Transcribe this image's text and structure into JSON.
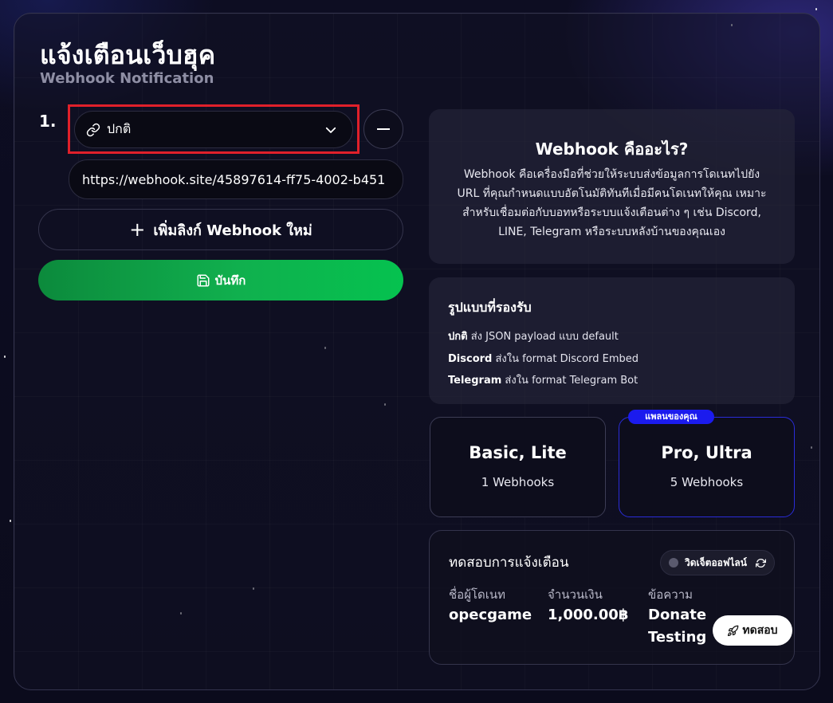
{
  "header": {
    "title": "แจ้งเตือนเว็บฮุค",
    "subtitle": "Webhook Notification"
  },
  "webhooks": {
    "item_number": "1.",
    "format_selected": "ปกติ",
    "url_value": "https://webhook.site/45897614-ff75-4002-b451",
    "add_label": "เพิ่มลิงก์ Webhook ใหม่",
    "save_label": "บันทึก"
  },
  "info": {
    "title": "Webhook คืออะไร?",
    "description": "Webhook คือเครื่องมือที่ช่วยให้ระบบส่งข้อมูลการโดเนทไปยัง URL ที่คุณกำหนดแบบอัตโนมัติทันทีเมื่อมีคนโดเนทให้คุณ เหมาะสำหรับเชื่อมต่อกับบอทหรือระบบแจ้งเตือนต่าง ๆ เช่น Discord, LINE, Telegram หรือระบบหลังบ้านของคุณเอง"
  },
  "formats": {
    "title": "รูปแบบที่รองรับ",
    "items": [
      {
        "name": "ปกติ",
        "desc": " ส่ง JSON payload แบบ default"
      },
      {
        "name": "Discord",
        "desc": " ส่งใน format Discord Embed"
      },
      {
        "name": "Telegram",
        "desc": " ส่งใน format Telegram Bot"
      }
    ]
  },
  "plans": {
    "badge": "แพลนของคุณ",
    "basic": {
      "name": "Basic, Lite",
      "count": "1 Webhooks"
    },
    "pro": {
      "name": "Pro, Ultra",
      "count": "5 Webhooks"
    }
  },
  "test": {
    "title": "ทดสอบการแจ้งเตือน",
    "widget_label": "วิดเจ็ตออฟไลน์",
    "fields": [
      {
        "label": "ชื่อผู้โดเนท",
        "value": "opecgame"
      },
      {
        "label": "จำนวนเงิน",
        "value": "1,000.00฿"
      },
      {
        "label": "ข้อความ",
        "value": "Donate Testing"
      }
    ],
    "button_label": "ทดสอบ"
  },
  "colors": {
    "accent_green": "#10b04e",
    "highlight_red": "#e0202a",
    "plan_blue": "#1b1bee",
    "background": "#0b0b1e"
  }
}
